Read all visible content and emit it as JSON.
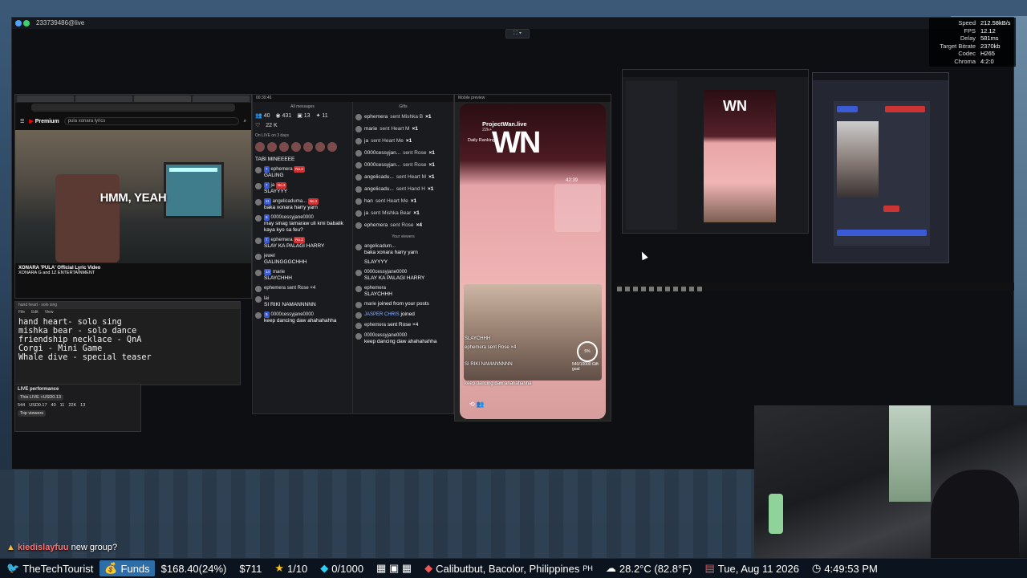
{
  "remote_viewer": {
    "title": "233739486@live"
  },
  "stats": [
    {
      "k": "Speed",
      "v": "212.58kB/s"
    },
    {
      "k": "FPS",
      "v": "12.12"
    },
    {
      "k": "Delay",
      "v": "581ms"
    },
    {
      "k": "Target Bitrate",
      "v": "2370kb"
    },
    {
      "k": "Codec",
      "v": "H265"
    },
    {
      "k": "Chroma",
      "v": "4:2:0"
    }
  ],
  "youtube": {
    "logo": "Premium",
    "search": "pula xonara lyrics",
    "lyric": "HMM, YEAH",
    "video_title": "XONARA 'PULA' Official Lyric Video",
    "channel": "XONARA G and 1Z ENTERTAINMENT"
  },
  "notepad": {
    "tab": "hand heart - solo sing",
    "menu": [
      "File",
      "Edit",
      "View"
    ],
    "lines": [
      "hand heart- solo sing",
      "mishka bear - solo dance",
      "friendship necklace - QnA",
      "Corgi - Mini Game",
      "Whale dive - special teaser"
    ]
  },
  "live_performance": {
    "title": "LIVE performance",
    "subtitle": "This LIVE +USD0.13",
    "stats": [
      "544",
      "USD0.17",
      "40",
      "11",
      "22K",
      "13"
    ],
    "top_viewers": "Top viewers"
  },
  "chat": {
    "header_time": "00:39:46",
    "left_title": "All messages",
    "right_title": "Gifts",
    "stats": [
      "40",
      "431",
      "13",
      "11"
    ],
    "likes": "22 K",
    "on_live": "On LIVE on 3 days",
    "left_messages": [
      {
        "name": "",
        "text": "TABI MINEEEEE"
      },
      {
        "name": "ephemera",
        "text": "GALING"
      },
      {
        "name": "ja",
        "text": "SLAYYYY"
      },
      {
        "name": "angelicaduma...",
        "text": "baka xonara harry yarn"
      },
      {
        "name": "0000cessyjane0000",
        "text": "may sinag tamaraw uli kmi babalik kaya kyo sa feu?"
      },
      {
        "name": "ephemera",
        "text": "SLAY KA PALAGI HARRY"
      },
      {
        "name": "jewel",
        "text": "GALINGGGCHHH"
      },
      {
        "name": "marie",
        "text": "SLAYCHHH"
      },
      {
        "name": "ephemera",
        "text": "sent Rose ×4"
      },
      {
        "name": "lai",
        "text": "SI RIKI NAMANNNNN"
      },
      {
        "name": "0000cessyjane0000",
        "text": "keep dancing daw ahahahahha"
      }
    ],
    "gift_lines": [
      {
        "name": "ephemera",
        "gift": "sent Mishka B",
        "x": "×1"
      },
      {
        "name": "marie",
        "gift": "sent Heart M",
        "x": "×1"
      },
      {
        "name": "ja",
        "gift": "sent Heart Me",
        "x": "×1"
      },
      {
        "name": "0000cessyjan...",
        "gift": "sent Rose",
        "x": "×1"
      },
      {
        "name": "0000cessyjan...",
        "gift": "sent Rose",
        "x": "×1"
      },
      {
        "name": "angelicadu...",
        "gift": "sent Heart M",
        "x": "×1"
      },
      {
        "name": "angelicadu...",
        "gift": "sent Hand H",
        "x": "×1"
      },
      {
        "name": "han",
        "gift": "sent Heart Me",
        "x": "×1"
      },
      {
        "name": "ja",
        "gift": "sent Mishka Bear",
        "x": "×1"
      },
      {
        "name": "ephemera",
        "gift": "sent Rose",
        "x": "×4"
      }
    ],
    "right_subtitle": "Your viewers",
    "right_messages": [
      {
        "name": "angelicadum...",
        "text": "baka xonara harry yarn"
      },
      {
        "name": "",
        "text": "SLAYYYY"
      },
      {
        "name": "0000cessyjane0000",
        "text": "SLAY KA PALAGI HARRY"
      },
      {
        "name": "ephemera",
        "text": "SLAYCHHH"
      },
      {
        "name": "marie",
        "text": "joined from your posts"
      },
      {
        "name": "JASPER CHRIS",
        "text": "joined"
      },
      {
        "name": "ephemera",
        "text": "sent Rose ×4"
      },
      {
        "name": "0000cessyjane0000",
        "text": "keep dancing daw ahahahahha"
      }
    ]
  },
  "mobile": {
    "header": "Mobile preview",
    "name": "ProjectWan.live",
    "likes": "22k+",
    "daily": "Daily Ranking",
    "logo": "WN",
    "timer": "42:39",
    "comment1": "SLAYCHHH",
    "comment2": "ephemera sent Rose ×4",
    "comment3": "SI RIKI NAMANNNNN",
    "comment4": "keep dancing daw ahahahahha",
    "goal": "5%",
    "goal_text": "540/10000 Gift goal"
  },
  "studio": {
    "logo": "WN"
  },
  "chatline": {
    "user": "kiedislayfuu",
    "message": "new group?"
  },
  "overlay": {
    "handle": "TheTechTourist",
    "funds_label": "Funds",
    "funds_value": "$168.40(24%)",
    "value2": "$711",
    "stars": "1/10",
    "gems": "0/1000",
    "location": "Calibutbut, Bacolor, Philippines",
    "location_cc": "PH",
    "temp": "28.2°C (82.8°F)",
    "date": "Tue, Aug 11 2026",
    "time": "4:49:53 PM"
  },
  "colors": {
    "accent_twitter": "#1da1f2",
    "funds_bg": "#2d6ea8",
    "star": "#f7c31a",
    "gem": "#2ad0f5",
    "chat_user": "#ff7070"
  }
}
